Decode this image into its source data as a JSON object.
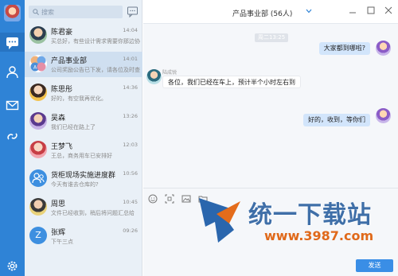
{
  "search": {
    "placeholder": "搜索"
  },
  "conversations": [
    {
      "name": "陈君豪",
      "preview": "买总好，有些设计需求需要你那边协",
      "time": "14:04",
      "avatar": "photo",
      "selected": false
    },
    {
      "name": "产品事业部",
      "preview": "公司奖励公告已下发，请各位及时查",
      "time": "14:01",
      "avatar": "group",
      "selected": true
    },
    {
      "name": "陈思彤",
      "preview": "好的，有空我再优化。",
      "time": "14:36",
      "avatar": "photo",
      "selected": false
    },
    {
      "name": "吴森",
      "preview": "我们已经在路上了",
      "time": "13:26",
      "avatar": "photo",
      "selected": false
    },
    {
      "name": "王梦飞",
      "preview": "王总，商务用车已安排好",
      "time": "12:03",
      "avatar": "photo",
      "selected": false
    },
    {
      "name": "货柜现场实施进度群",
      "preview": "今天有谁去仓库的?",
      "time": "10:56",
      "avatar": "group-icon",
      "selected": false
    },
    {
      "name": "周思",
      "preview": "文件已经收到，稍后将问题汇总给",
      "time": "10:45",
      "avatar": "photo",
      "selected": false
    },
    {
      "name": "张辉",
      "preview": "下午三点",
      "time": "09:26",
      "avatar": "letter",
      "letter": "Z",
      "selected": false
    }
  ],
  "chat": {
    "title": "产品事业部 (56人)",
    "timestamp": "周二13:25",
    "messages": [
      {
        "direction": "out",
        "text": "大家都到哪啦?"
      },
      {
        "direction": "in",
        "sender": "陆成锐",
        "text": "各位，我们已经在车上，预计半个小时左右到"
      },
      {
        "direction": "out",
        "text": "好的，收到，等你们"
      }
    ],
    "send_label": "发送"
  },
  "watermark": {
    "text": "统一下载站",
    "url": "www.3987.com"
  },
  "colors": {
    "rail": "#2f83d6",
    "accent": "#3a8ee6",
    "bubble_out": "#d2e5fb"
  }
}
